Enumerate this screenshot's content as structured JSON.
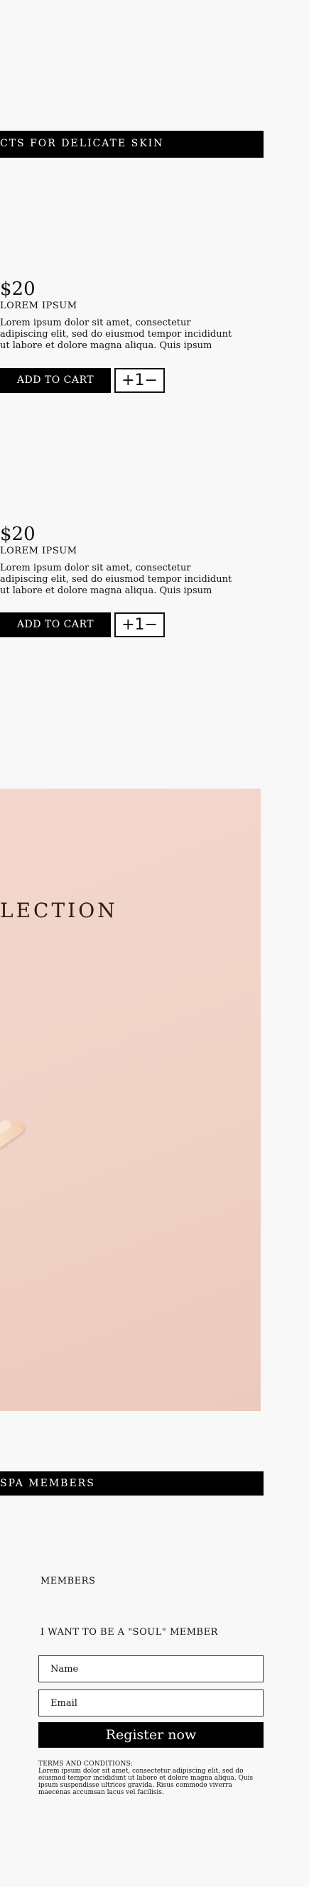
{
  "top_banner": {
    "text": "CTS FOR DELICATE SKIN"
  },
  "products": [
    {
      "price": "$20",
      "name": "LOREM IPSUM",
      "description": "Lorem ipsum dolor sit amet, consectetur adipiscing elit, sed do eiusmod tempor incididunt ut labore et dolore magna aliqua. Quis ipsum",
      "cart_label": "ADD TO CART",
      "stepper_plus": "+",
      "stepper_value": "1",
      "stepper_minus": "−"
    },
    {
      "price": "$20",
      "name": "LOREM IPSUM",
      "description": "Lorem ipsum dolor sit amet, consectetur adipiscing elit, sed do eiusmod tempor incididunt ut labore et dolore magna aliqua. Quis ipsum",
      "cart_label": "ADD TO CART",
      "stepper_plus": "+",
      "stepper_value": "1",
      "stepper_minus": "−"
    }
  ],
  "promo": {
    "title": "LECTION",
    "background": "#f1d3c8"
  },
  "members_banner": {
    "text": "SPA MEMBERS"
  },
  "signup": {
    "heading": "MEMBERS",
    "subheading": "I WANT TO BE A \"SOUL\" MEMBER",
    "name_placeholder": "Name",
    "email_placeholder": "Email",
    "register_label": "Register now",
    "terms_title": "TERMS AND CONDITIONS:",
    "terms_text": "Lorem ipsum dolor sit amet, consectetur adipiscing elit, sed do eiusmod tempor incididunt ut labore et dolore magna aliqua. Quis ipsum suspendisse ultrices gravida. Risus commodo viverra maecenas accumsan lacus vel facilisis."
  }
}
